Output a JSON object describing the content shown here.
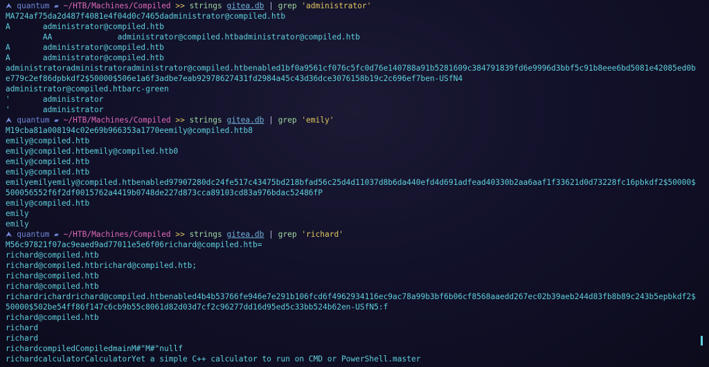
{
  "prompt": {
    "user": "quantum",
    "path": "~/HTB/Machines/Compiled",
    "separator": ">>"
  },
  "blocks": [
    {
      "command": {
        "prog": "strings",
        "file": "gitea.db",
        "pipe": "|",
        "grep": "grep",
        "pattern": "'administrator'"
      },
      "lines": [
        "MA724af75da2d487f4081e4f04d0c7465dadministrator@compiled.htb",
        "A       administrator@compiled.htb",
        "        AA              administrator@compiled.htbadministrator@compiled.htb",
        "A       administrator@compiled.htb",
        "A       administrator@compiled.htb",
        "administratoradministratoradministrator@compiled.htbenabled1bf0a9561cf076c5fc0d76e140788a91b5281609c384791839fd6e9996d3bbf5c91b8eee6bd5081e42085ed0b",
        "e779c2ef86dpbkdf2$50000$506e1a6f3adbe7eab92978627431fd2984a45c43d36dce3076158b19c2c696ef7ben-USfN4",
        "administrator@compiled.htbarc-green",
        "'       administrator",
        "'       administrator"
      ]
    },
    {
      "command": {
        "prog": "strings",
        "file": "gitea.db",
        "pipe": "|",
        "grep": "grep",
        "pattern": "'emily'"
      },
      "lines": [
        "M19cba81a008194c02e69b966353a1770eemily@compiled.htb8",
        "emily@compiled.htb",
        "emily@compiled.htbemily@compiled.htb0",
        "emily@compiled.htb",
        "emily@compiled.htb",
        "emilyemilyemily@compiled.htbenabled97907280dc24fe517c43475bd218bfad56c25d4d11037d8b6da440efd4d691adfead40330b2aa6aaf1f33621d0d73228fc16pbkdf2$50000$",
        "500056552f6f2df0015762a4419b0748de227d873cca89103cd83a976bdac52486fP",
        "emily@compiled.htb",
        "emily",
        "emily"
      ]
    },
    {
      "command": {
        "prog": "strings",
        "file": "gitea.db",
        "pipe": "|",
        "grep": "grep",
        "pattern": "'richard'"
      },
      "lines": [
        "M56c97821f07ac9eaed9ad77011e5e6f06richard@compiled.htb=",
        "richard@compiled.htb",
        "richard@compiled.htbrichard@compiled.htb;",
        "richard@compiled.htb",
        "richard@compiled.htb",
        "richardrichardrichard@compiled.htbenabled4b4b53766fe946e7e291b106fcd6f4962934116ec9ac78a99b3bf6b06cf8568aaedd267ec02b39aeb244d83fb8b89c243b5epbkdf2$",
        "50000$502be54ff86f147c6cb9b55c8061d82d03d7cf2c96277dd16d95ed5c33bb524b62en-USfN5:f",
        "richard@compiled.htb",
        "richard",
        "richard",
        "richardcompiledCompiledmainM#\"M#\"nullf",
        "richardcalculatorCalculatorYet a simple C++ calculator to run on CMD or PowerShell.master"
      ]
    }
  ]
}
